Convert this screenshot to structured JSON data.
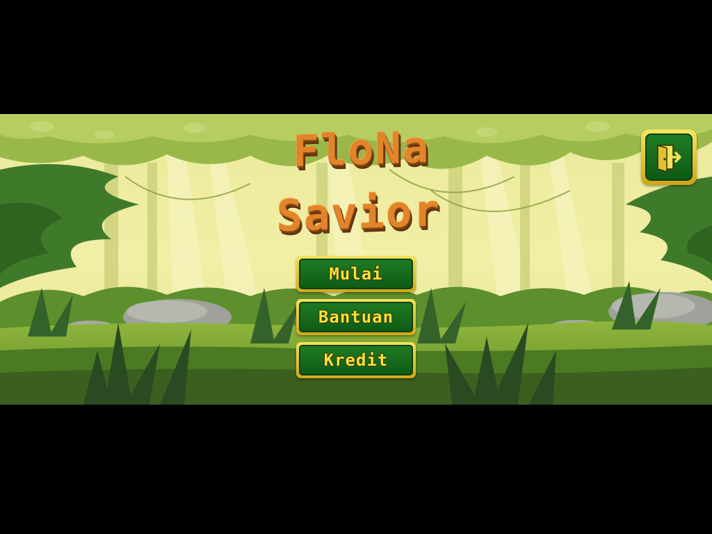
{
  "game": {
    "title_line_1": "FloNa",
    "title_line_2": "Savior"
  },
  "menu": {
    "start_label": "Mulai",
    "help_label": "Bantuan",
    "credits_label": "Kredit"
  },
  "exit_button": {
    "icon": "exit-door-icon"
  },
  "colors": {
    "letterbox": "#000000",
    "title_orange": "#e2842a",
    "button_green": "#1e7a22",
    "button_gold": "#f4e35a",
    "button_text": "#f6e23a"
  }
}
